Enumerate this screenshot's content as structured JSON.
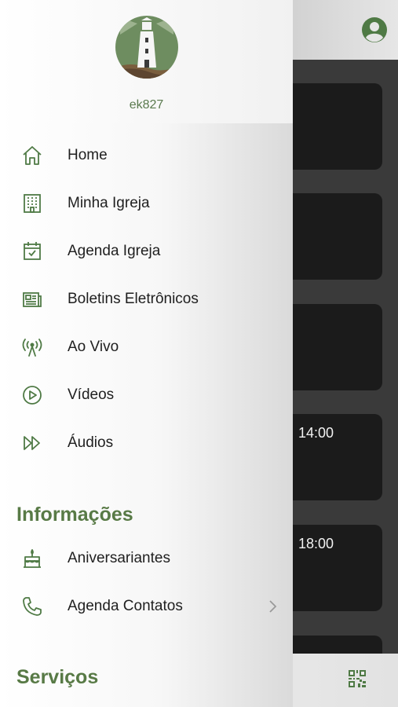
{
  "colors": {
    "accent": "#587a46",
    "icon": "#4f7a45"
  },
  "drawer": {
    "username": "ek827",
    "items": [
      {
        "label": "Home",
        "icon": "home-icon"
      },
      {
        "label": "Minha Igreja",
        "icon": "building-icon"
      },
      {
        "label": "Agenda Igreja",
        "icon": "calendar-check-icon"
      },
      {
        "label": "Boletins Eletrônicos",
        "icon": "newspaper-icon"
      },
      {
        "label": "Ao Vivo",
        "icon": "broadcast-icon"
      },
      {
        "label": "Vídeos",
        "icon": "play-circle-icon"
      },
      {
        "label": "Áudios",
        "icon": "fast-forward-icon"
      }
    ],
    "section_informacoes": "Informações",
    "info_items": [
      {
        "label": "Aniversariantes",
        "icon": "cake-icon"
      },
      {
        "label": "Agenda Contatos",
        "icon": "phone-icon"
      }
    ],
    "section_servicos": "Serviços"
  },
  "background": {
    "times": [
      "14:00",
      "18:00"
    ]
  }
}
